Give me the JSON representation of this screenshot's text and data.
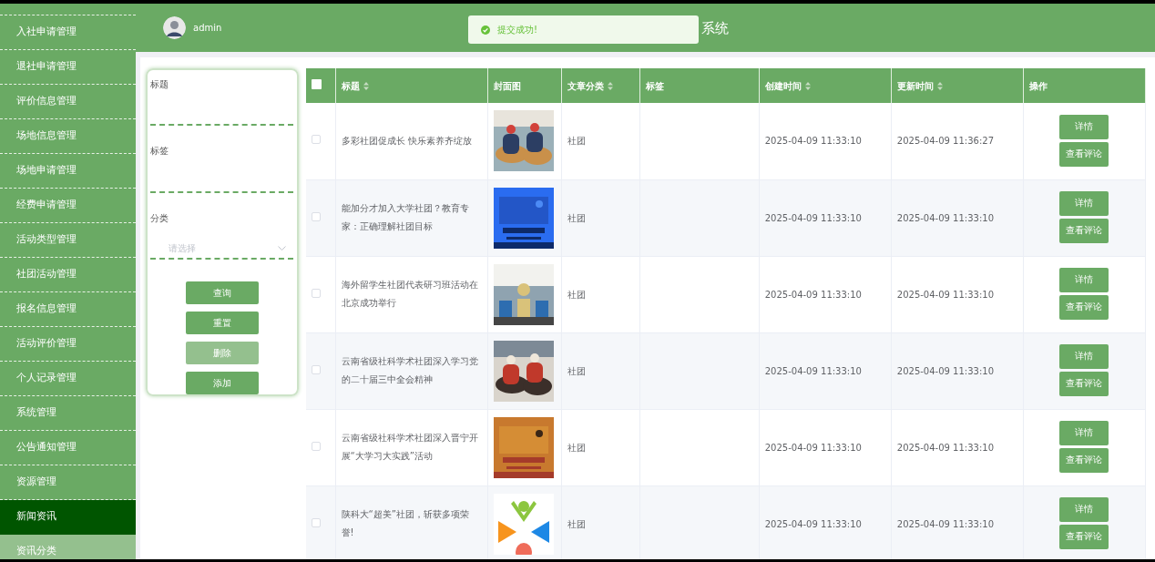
{
  "sidebar": {
    "items": [
      {
        "label": "入社申请管理",
        "kind": "item",
        "selected": false
      },
      {
        "label": "退社申请管理",
        "kind": "item",
        "selected": false
      },
      {
        "label": "评价信息管理",
        "kind": "item",
        "selected": false
      },
      {
        "label": "场地信息管理",
        "kind": "item",
        "selected": false
      },
      {
        "label": "场地申请管理",
        "kind": "item",
        "selected": false
      },
      {
        "label": "经费申请管理",
        "kind": "item",
        "selected": false
      },
      {
        "label": "活动类型管理",
        "kind": "item",
        "selected": false
      },
      {
        "label": "社团活动管理",
        "kind": "item",
        "selected": false
      },
      {
        "label": "报名信息管理",
        "kind": "item",
        "selected": false
      },
      {
        "label": "活动评价管理",
        "kind": "item",
        "selected": false
      },
      {
        "label": "个人记录管理",
        "kind": "item",
        "selected": false
      },
      {
        "label": "系统管理",
        "kind": "item",
        "selected": false
      },
      {
        "label": "公告通知管理",
        "kind": "item",
        "selected": false
      },
      {
        "label": "资源管理",
        "kind": "item",
        "selected": false
      },
      {
        "label": "新闻资讯",
        "kind": "item",
        "selected": true
      },
      {
        "label": "资讯分类",
        "kind": "sub",
        "selected": false
      }
    ]
  },
  "header": {
    "user": "admin",
    "title": "系统"
  },
  "toast": {
    "message": "提交成功!"
  },
  "search": {
    "fields": [
      {
        "label": "标题",
        "kind": "text"
      },
      {
        "label": "标签",
        "kind": "text"
      },
      {
        "label": "分类",
        "kind": "select",
        "placeholder": "请选择"
      }
    ],
    "buttons": [
      {
        "label": "查询",
        "disabled": false
      },
      {
        "label": "重置",
        "disabled": false
      },
      {
        "label": "删除",
        "disabled": true
      },
      {
        "label": "添加",
        "disabled": false
      }
    ]
  },
  "table": {
    "select_all": {
      "checked": false
    },
    "columns": [
      {
        "label": "标题",
        "sortable": true
      },
      {
        "label": "封面图",
        "sortable": false
      },
      {
        "label": "文章分类",
        "sortable": true
      },
      {
        "label": "标签",
        "sortable": false
      },
      {
        "label": "创建时间",
        "sortable": true
      },
      {
        "label": "更新时间",
        "sortable": true
      },
      {
        "label": "操作",
        "sortable": false
      }
    ],
    "rows": [
      {
        "checked": false,
        "title": "多彩社团促成长 快乐素养齐绽放",
        "category": "社团",
        "created": "2025-04-09 11:33:10",
        "updated": "2025-04-09 11:36:27",
        "actions": [
          "详情",
          "查看评论"
        ]
      },
      {
        "checked": false,
        "title": "能加分才加入大学社团？教育专家：正确理解社团目标",
        "category": "社团",
        "created": "2025-04-09 11:33:10",
        "updated": "2025-04-09 11:33:10",
        "actions": [
          "详情",
          "查看评论"
        ]
      },
      {
        "checked": false,
        "title": "海外留学生社团代表研习班活动在北京成功举行",
        "category": "社团",
        "created": "2025-04-09 11:33:10",
        "updated": "2025-04-09 11:33:10",
        "actions": [
          "详情",
          "查看评论"
        ]
      },
      {
        "checked": false,
        "title": "云南省级社科学术社团深入学习党的二十届三中全会精神",
        "category": "社团",
        "created": "2025-04-09 11:33:10",
        "updated": "2025-04-09 11:33:10",
        "actions": [
          "详情",
          "查看评论"
        ]
      },
      {
        "checked": false,
        "title": "云南省级社科学术社团深入晋宁开展“大学习大实践”活动",
        "category": "社团",
        "created": "2025-04-09 11:33:10",
        "updated": "2025-04-09 11:33:10",
        "actions": [
          "详情",
          "查看评论"
        ]
      },
      {
        "checked": false,
        "title": "陕科大“超美”社团，斩获多项荣誉!",
        "category": "社团",
        "created": "2025-04-09 11:33:10",
        "updated": "2025-04-09 11:33:10",
        "actions": [
          "详情",
          "查看评论"
        ]
      }
    ]
  }
}
